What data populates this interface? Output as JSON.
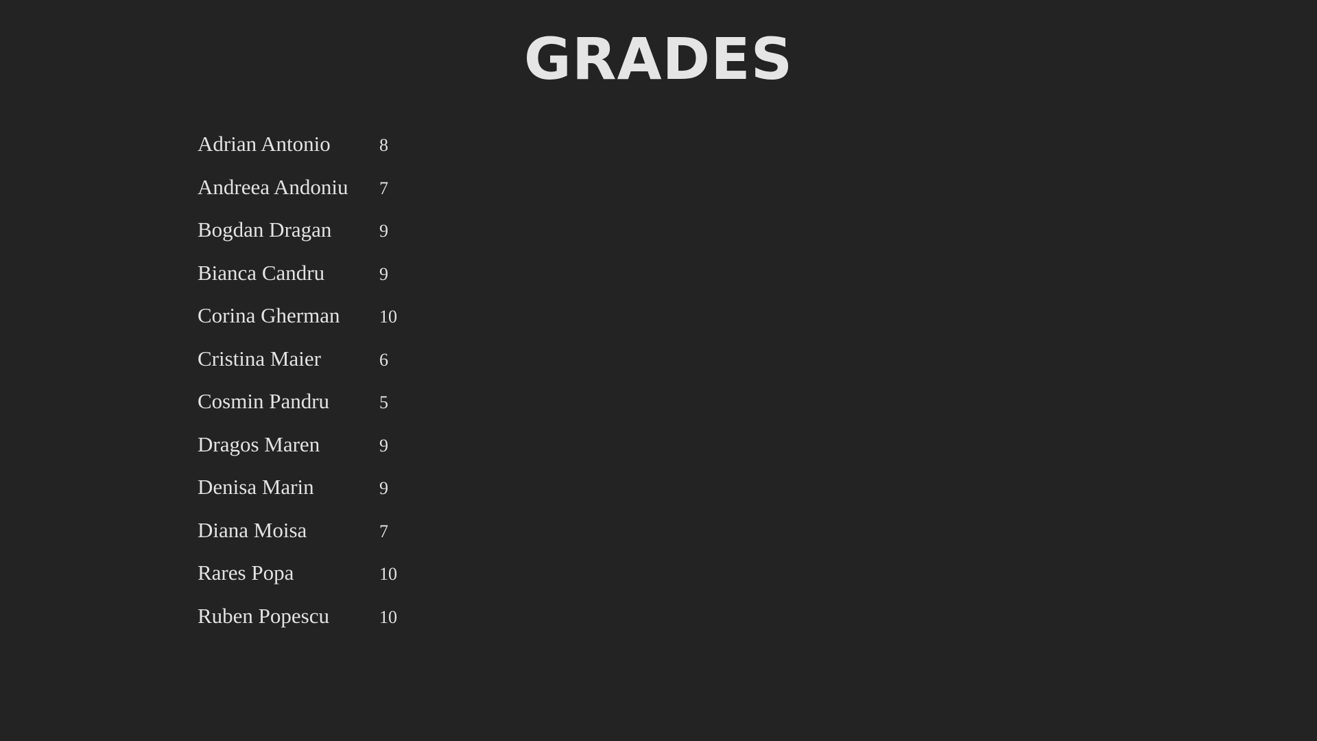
{
  "slide": {
    "title": "GRADES",
    "students": [
      {
        "name": "Adrian Antonio",
        "grade": "8"
      },
      {
        "name": "Andreea Andoniu",
        "grade": "7"
      },
      {
        "name": "Bogdan Dragan",
        "grade": "9"
      },
      {
        "name": "Bianca Candru",
        "grade": "9"
      },
      {
        "name": "Corina Gherman",
        "grade": "10"
      },
      {
        "name": "Cristina Maier",
        "grade": "6"
      },
      {
        "name": "Cosmin Pandru",
        "grade": "5"
      },
      {
        "name": "Dragos Maren",
        "grade": "9"
      },
      {
        "name": "Denisa Marin",
        "grade": "9"
      },
      {
        "name": "Diana Moisa",
        "grade": "7"
      },
      {
        "name": "Rares Popa",
        "grade": "10"
      },
      {
        "name": "Ruben Popescu",
        "grade": "10"
      }
    ]
  },
  "colors": {
    "background": "#232323",
    "text": "#e3e3e3"
  }
}
